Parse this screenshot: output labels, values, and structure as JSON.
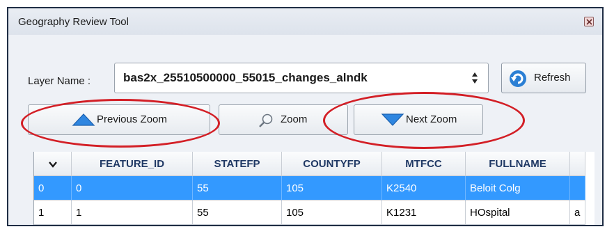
{
  "window": {
    "title": "Geography Review Tool"
  },
  "layer": {
    "label": "Layer Name :",
    "value": "bas2x_25510500000_55015_changes_alndk",
    "refresh_label": "Refresh"
  },
  "toolbar": {
    "previous_zoom": "Previous Zoom",
    "zoom": "Zoom",
    "next_zoom": "Next Zoom"
  },
  "table": {
    "columns": [
      "",
      "FEATURE_ID",
      "STATEFP",
      "COUNTYFP",
      "MTFCC",
      "FULLNAME"
    ],
    "rows": [
      {
        "index": "0",
        "feature_id": "0",
        "statefp": "55",
        "countyfp": "105",
        "mtfcc": "K2540",
        "fullname": "Beloit Colg",
        "selected": true
      },
      {
        "index": "1",
        "feature_id": "1",
        "statefp": "55",
        "countyfp": "105",
        "mtfcc": "K1231",
        "fullname": "HOspital",
        "extra": "a",
        "selected": false
      }
    ]
  },
  "colors": {
    "selection": "#3399ff",
    "highlight": "#d31f26",
    "header_text": "#1f3864"
  },
  "icons": [
    "close-icon",
    "select-arrows-icon",
    "refresh-icon",
    "up-triangle-icon",
    "magnifier-icon",
    "down-triangle-icon",
    "chevron-down-icon"
  ]
}
